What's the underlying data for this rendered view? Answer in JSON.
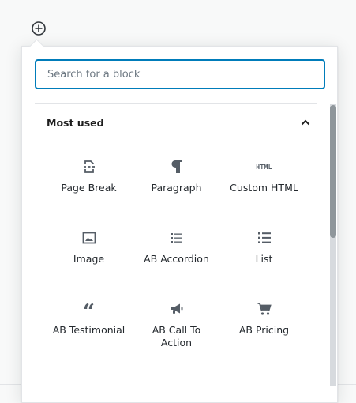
{
  "search": {
    "placeholder": "Search for a block"
  },
  "panel": {
    "title": "Most used",
    "expanded": true
  },
  "blocks": [
    {
      "label": "Page Break",
      "icon": "page-break-icon"
    },
    {
      "label": "Paragraph",
      "icon": "paragraph-icon"
    },
    {
      "label": "Custom HTML",
      "icon": "html-icon",
      "glyph": "HTML"
    },
    {
      "label": "Image",
      "icon": "image-icon"
    },
    {
      "label": "AB Accordion",
      "icon": "accordion-list-icon"
    },
    {
      "label": "List",
      "icon": "list-icon"
    },
    {
      "label": "AB Testimonial",
      "icon": "quote-icon",
      "glyph": "“"
    },
    {
      "label": "AB Call To Action",
      "icon": "megaphone-icon"
    },
    {
      "label": "AB Pricing",
      "icon": "cart-icon"
    }
  ],
  "colors": {
    "accent": "#007cba",
    "icon": "#555d66",
    "border": "#e2e4e7"
  }
}
